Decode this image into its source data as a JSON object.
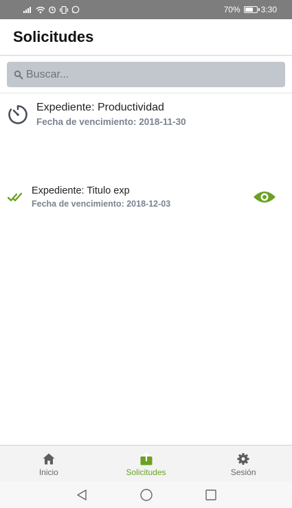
{
  "status_bar": {
    "icons": [
      "signal-icon",
      "wifi-icon",
      "alarm-icon",
      "vibrate-icon",
      "whatsapp-icon"
    ],
    "battery_percent": "70%",
    "time": "3:30"
  },
  "header": {
    "title": "Solicitudes"
  },
  "search": {
    "placeholder": "Buscar..."
  },
  "requests": [
    {
      "title": "Expediente: Productividad",
      "due": "Fecha de vencimiento: 2018-11-30",
      "state_icon": "pending-clock-icon"
    },
    {
      "title": "Expediente: Titulo exp",
      "due": "Fecha de vencimiento: 2018-12-03",
      "state_icon": "double-check-icon",
      "action_icon": "eye-icon"
    }
  ],
  "bottom_nav": {
    "items": [
      {
        "label": "Inicio",
        "icon": "home-icon"
      },
      {
        "label": "Solicitudes",
        "icon": "upload-box-icon",
        "active": true
      },
      {
        "label": "Sesión",
        "icon": "gear-icon"
      }
    ]
  },
  "colors": {
    "accent": "#6aa120",
    "status_bar": "#7d7d7d",
    "search_bg": "#c1c7cd",
    "secondary_text": "#7a8390"
  }
}
